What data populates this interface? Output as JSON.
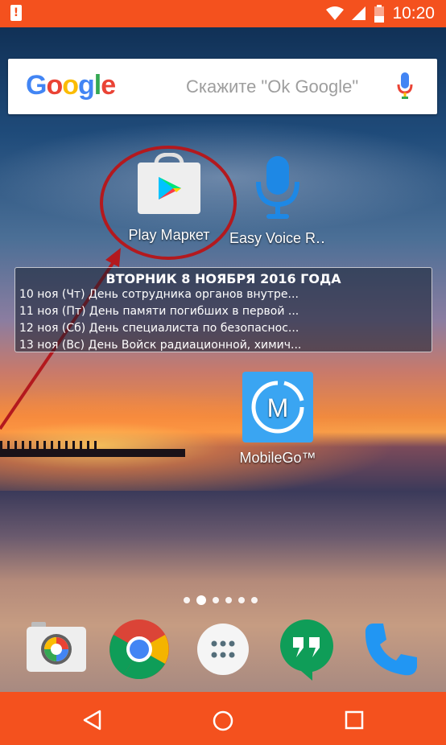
{
  "status_bar": {
    "time": "10:20",
    "icons": [
      "alert-icon",
      "wifi-icon",
      "signal-icon",
      "battery-icon"
    ]
  },
  "search_widget": {
    "logo": "Google",
    "hint": "Скажите \"Ok Google\""
  },
  "apps": [
    {
      "name": "play-market",
      "label": "Play Маркет"
    },
    {
      "name": "easy-voice",
      "label": "Easy Voice R‥"
    },
    {
      "name": "mobilego",
      "label": "MobileGo™"
    }
  ],
  "calendar_widget": {
    "title": "ВТОРНИК 8 НОЯБРЯ 2016 ГОДА",
    "rows": [
      "10 ноя (Чт) День сотрудника органов внутре...",
      "11 ноя (Пт) День памяти погибших в первой ...",
      "12 ноя (Сб) День специалиста по безопаснос...",
      "13 ноя (Вс) День Войск радиационной, химич..."
    ]
  },
  "page_indicator": {
    "count": 6,
    "active": 1
  },
  "dock": [
    "camera-icon",
    "chrome-icon",
    "app-drawer-icon",
    "hangouts-icon",
    "phone-icon"
  ],
  "nav_bar": [
    "back-button",
    "home-button",
    "recents-button"
  ],
  "colors": {
    "status_bar": "#f4511e",
    "nav_bar": "#f4511e",
    "annotation": "#b3191e"
  }
}
